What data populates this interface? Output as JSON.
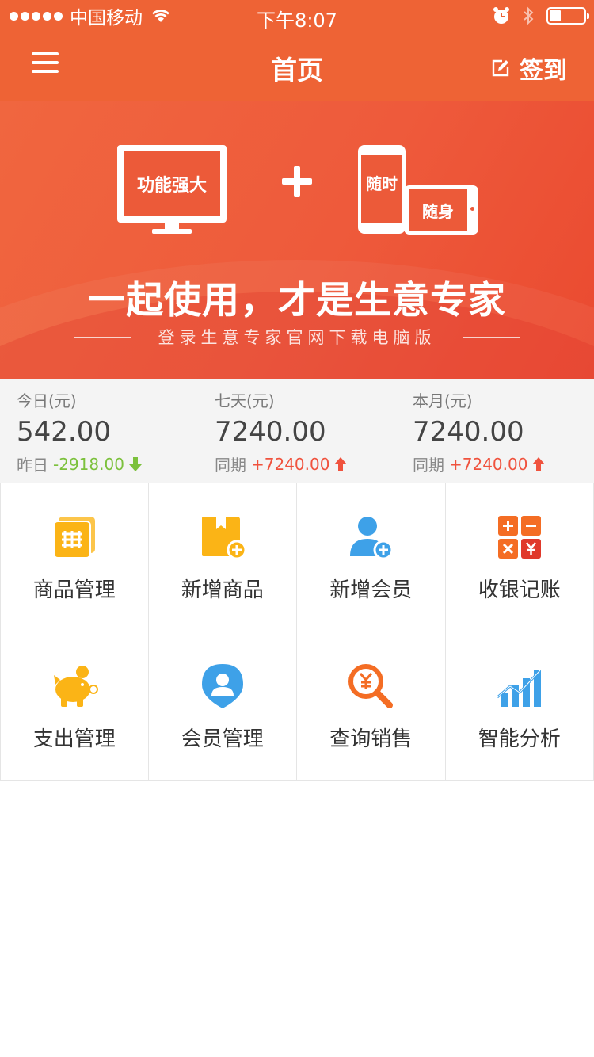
{
  "status": {
    "carrier": "中国移动",
    "time": "下午8:07"
  },
  "nav": {
    "title": "首页",
    "signin": "签到"
  },
  "banner": {
    "monitor_text": "功能强大",
    "phone_text": "随时",
    "tablet_text": "随身",
    "slogan": "一起使用，才是生意专家",
    "subline": "登录生意专家官网下载电脑版"
  },
  "stats": [
    {
      "label": "今日(元)",
      "value": "542.00",
      "cmp_label": "昨日",
      "cmp_value": "-2918.00",
      "trend": "down"
    },
    {
      "label": "七天(元)",
      "value": "7240.00",
      "cmp_label": "同期",
      "cmp_value": "+7240.00",
      "trend": "up"
    },
    {
      "label": "本月(元)",
      "value": "7240.00",
      "cmp_label": "同期",
      "cmp_value": "+7240.00",
      "trend": "up"
    }
  ],
  "grid": [
    {
      "label": "商品管理",
      "icon": "product-manage-icon"
    },
    {
      "label": "新增商品",
      "icon": "add-product-icon"
    },
    {
      "label": "新增会员",
      "icon": "add-member-icon"
    },
    {
      "label": "收银记账",
      "icon": "cashier-icon"
    },
    {
      "label": "支出管理",
      "icon": "piggy-bank-icon"
    },
    {
      "label": "会员管理",
      "icon": "member-location-icon"
    },
    {
      "label": "查询销售",
      "icon": "search-sales-icon"
    },
    {
      "label": "智能分析",
      "icon": "analytics-chart-icon"
    }
  ],
  "colors": {
    "brand": "#ee6335",
    "up": "#f0523d",
    "down": "#7cc13c",
    "yellow": "#fbb416",
    "blue": "#3ea1e8"
  }
}
